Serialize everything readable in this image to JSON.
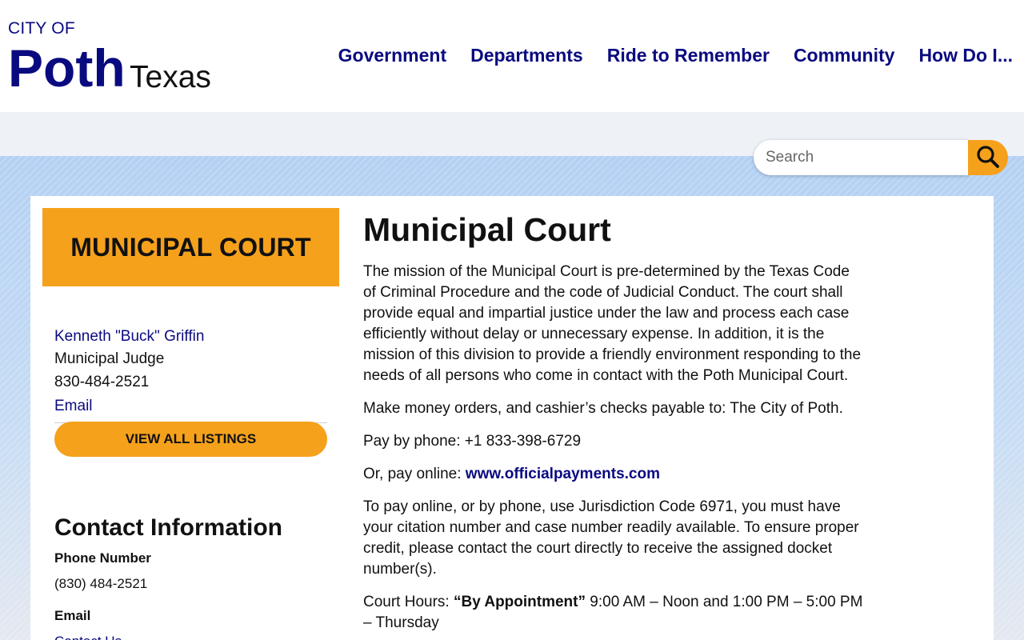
{
  "header": {
    "logo_cityof": "CITY OF",
    "logo_city": "Poth",
    "logo_state": "Texas",
    "nav": [
      {
        "label": "Government"
      },
      {
        "label": "Departments"
      },
      {
        "label": "Ride to Remember"
      },
      {
        "label": "Community"
      },
      {
        "label": "How Do I..."
      }
    ]
  },
  "search": {
    "placeholder": "Search",
    "value": ""
  },
  "sidebar": {
    "department_title": "MUNICIPAL COURT",
    "staff_name": "Kenneth \"Buck\" Griffin",
    "staff_title": "Municipal Judge",
    "staff_phone": "830-484-2521",
    "staff_email_label": "Email",
    "view_all_label": "VIEW ALL LISTINGS",
    "contact": {
      "heading": "Contact Information",
      "phone_label": "Phone Number",
      "phone_value": "(830) 484-2521",
      "email_label": "Email",
      "email_value": "Contact Us"
    }
  },
  "main": {
    "title": "Municipal Court",
    "paragraph1": "The mission of the Municipal Court is pre-determined by the Texas Code of Criminal Procedure and the code of Judicial Conduct. The court shall provide equal and impartial justice under the law and process each case efficiently without delay or unnecessary expense. In addition, it is the mission of this division to provide a friendly environment responding to the needs of all persons who come in contact with the Poth Municipal Court.",
    "paragraph2": "Make  money orders, and cashier’s checks payable to: The City of Poth.",
    "paragraph3": "Pay by phone: +1 833-398-6729",
    "paragraph4_prefix": "Or, pay online: ",
    "paragraph4_link": "www.officialpayments.com",
    "paragraph5": "To pay online, or by phone, use Jurisdiction Code 6971, you must have your citation number and case number readily available. To ensure proper credit, please contact the court directly to receive the assigned docket number(s).",
    "hours_prefix": "Court Hours:  ",
    "hours_bold": "“By Appointment”",
    "hours_suffix": "  9:00 AM – Noon and 1:00 PM – 5:00 PM – Thursday"
  },
  "colors": {
    "brand_navy": "#0a0a80",
    "accent_orange": "#f5a11c",
    "band_blue": "#b3d0f3"
  }
}
